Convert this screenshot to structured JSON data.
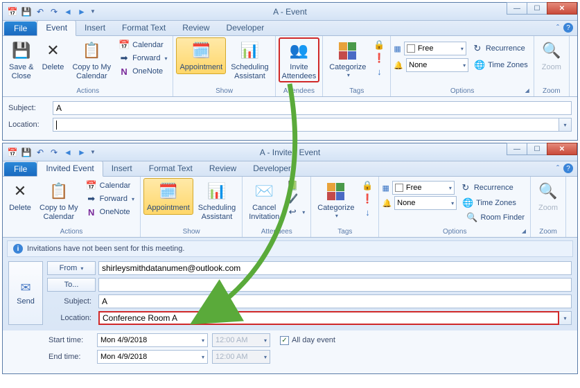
{
  "win1": {
    "title": "A - Event",
    "tabs": {
      "file": "File",
      "event": "Event",
      "insert": "Insert",
      "format": "Format Text",
      "review": "Review",
      "developer": "Developer"
    },
    "ribbon": {
      "actions": {
        "save_close": "Save &\nClose",
        "delete": "Delete",
        "copy": "Copy to My\nCalendar",
        "calendar": "Calendar",
        "forward": "Forward",
        "onenote": "OneNote",
        "label": "Actions"
      },
      "show": {
        "appointment": "Appointment",
        "scheduling": "Scheduling\nAssistant",
        "label": "Show"
      },
      "attendees": {
        "invite": "Invite\nAttendees",
        "label": "Attendees"
      },
      "tags": {
        "categorize": "Categorize",
        "label": "Tags"
      },
      "options": {
        "show_as_label": "",
        "show_as_value": "Free",
        "reminder_value": "None",
        "recurrence": "Recurrence",
        "timezones": "Time Zones",
        "label": "Options"
      },
      "zoom": {
        "zoom": "Zoom",
        "label": "Zoom"
      }
    },
    "form": {
      "subject_label": "Subject:",
      "subject_value": "A",
      "location_label": "Location:",
      "location_value": ""
    }
  },
  "win2": {
    "title": "A - Invited Event",
    "tabs": {
      "file": "File",
      "event": "Invited Event",
      "insert": "Insert",
      "format": "Format Text",
      "review": "Review",
      "developer": "Developer"
    },
    "ribbon": {
      "actions": {
        "delete": "Delete",
        "copy": "Copy to My\nCalendar",
        "calendar": "Calendar",
        "forward": "Forward",
        "onenote": "OneNote",
        "label": "Actions"
      },
      "show": {
        "appointment": "Appointment",
        "scheduling": "Scheduling\nAssistant",
        "label": "Show"
      },
      "attendees": {
        "cancel": "Cancel\nInvitation",
        "label": "Attendees"
      },
      "tags": {
        "categorize": "Categorize",
        "label": "Tags"
      },
      "options": {
        "show_as_value": "Free",
        "reminder_value": "None",
        "recurrence": "Recurrence",
        "timezones": "Time Zones",
        "roomfinder": "Room Finder",
        "label": "Options"
      },
      "zoom": {
        "zoom": "Zoom",
        "label": "Zoom"
      }
    },
    "info": "Invitations have not been sent for this meeting.",
    "compose": {
      "send": "Send",
      "from_label": "From",
      "from_value": "shirleysmithdatanumen@outlook.com",
      "to_label": "To...",
      "to_value": "",
      "subject_label": "Subject:",
      "subject_value": "A",
      "location_label": "Location:",
      "location_value": "Conference Room A"
    },
    "dt": {
      "start_label": "Start time:",
      "end_label": "End time:",
      "date": "Mon 4/9/2018",
      "time": "12:00 AM",
      "allday": "All day event"
    }
  }
}
